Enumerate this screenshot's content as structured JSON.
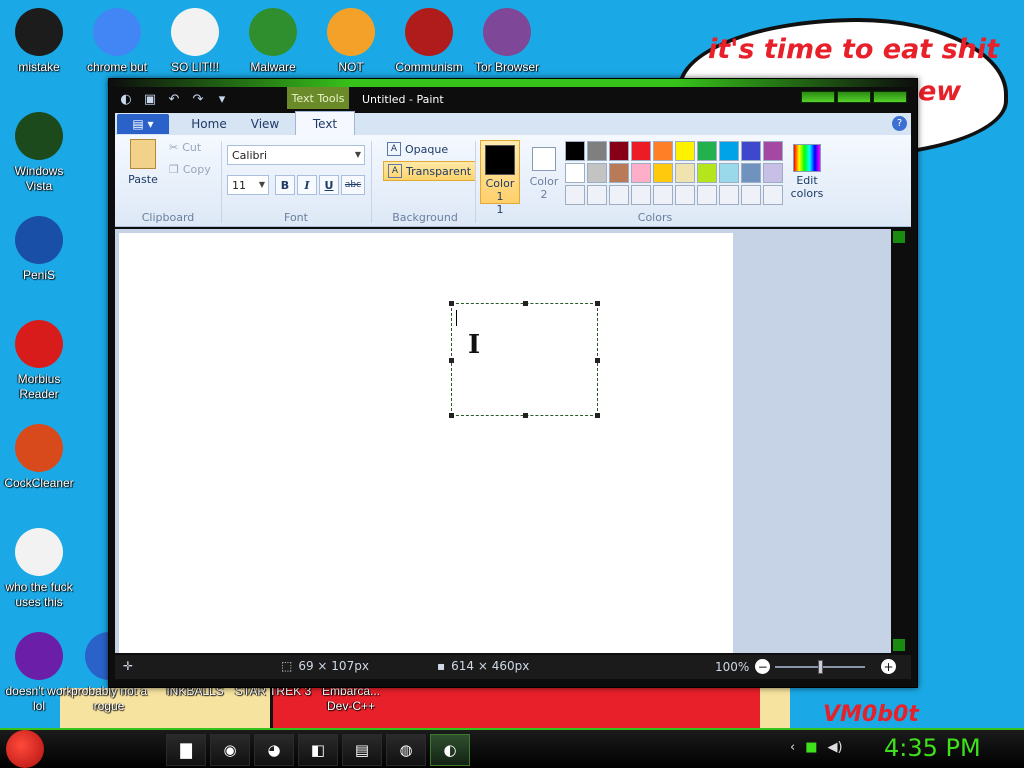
{
  "wallpaper": {
    "bubble_line1": "it's time to eat shit",
    "bubble_line2": "ew",
    "corner_text": "VM0b0t"
  },
  "desktop_icons": [
    {
      "label": "mistake",
      "icon": "razer-icon",
      "color": "#1c1c1c"
    },
    {
      "label": "chrome but nor",
      "icon": "chrome-icon",
      "color": "#4285f4"
    },
    {
      "label": "SO LIT!!!",
      "icon": "solitaire-icon",
      "color": "#f2f2f2"
    },
    {
      "label": "Malware",
      "icon": "shield-icon",
      "color": "#2f8f2f"
    },
    {
      "label": "NOT",
      "icon": "bad-piggies-icon",
      "color": "#f4a12a"
    },
    {
      "label": "Communism",
      "icon": "emblem-icon",
      "color": "#b01c1c"
    },
    {
      "label": "Tor Browser",
      "icon": "tor-icon",
      "color": "#7e4798"
    },
    {
      "label": "Windows Vista",
      "icon": "recycle-icon",
      "color": "#1c4a1c"
    },
    {
      "label": "PeniS",
      "icon": "photoshop-icon",
      "color": "#1a4fa8"
    },
    {
      "label": "Morbius Reader",
      "icon": "acrobat-icon",
      "color": "#d81c1c"
    },
    {
      "label": "CockCleaner",
      "icon": "ccleaner-icon",
      "color": "#d84a1c"
    },
    {
      "label": "who the fuck uses this",
      "icon": "bolt-icon",
      "color": "#f2f2f2"
    },
    {
      "label": "doesn't work lol",
      "icon": "yahoo-icon",
      "color": "#6b1fa8"
    },
    {
      "label": "probably not a rogue",
      "icon": "app-icon",
      "color": "#2a62c9"
    },
    {
      "label": "INKBALLS",
      "icon": "app-icon",
      "color": "#2a62c9"
    },
    {
      "label": "STAR TREK 3",
      "icon": "app-icon",
      "color": "#2a62c9"
    },
    {
      "label": "Embarca... Dev-C++",
      "icon": "app-icon",
      "color": "#2a62c9"
    }
  ],
  "window": {
    "title": "Untitled - Paint",
    "context_tab": "Text Tools",
    "tabs": [
      {
        "label": "Home",
        "active": false
      },
      {
        "label": "View",
        "active": false
      },
      {
        "label": "Text",
        "active": true
      }
    ],
    "clipboard": {
      "paste": "Paste",
      "cut": "Cut",
      "copy": "Copy",
      "group": "Clipboard"
    },
    "font": {
      "family": "Calibri",
      "size": "11",
      "bold": "B",
      "italic": "I",
      "underline": "U",
      "strike": "abc",
      "group": "Font"
    },
    "background": {
      "opaque": "Opaque",
      "transparent": "Transparent",
      "group": "Background"
    },
    "colors": {
      "color1_label": "Color 1",
      "color1_num": "1",
      "color2_label": "Color",
      "color2_num": "2",
      "edit_label": "Edit colors",
      "group": "Colors",
      "palette": [
        "#000000",
        "#7f7f7f",
        "#880015",
        "#ed1c24",
        "#ff7f27",
        "#fff200",
        "#22b14c",
        "#00a2e8",
        "#3f48cc",
        "#a349a4",
        "#ffffff",
        "#c3c3c3",
        "#b97a57",
        "#ffaec9",
        "#ffc90e",
        "#efe4b0",
        "#b5e61d",
        "#99d9ea",
        "#7092be",
        "#c8bfe7",
        "#eef2f8",
        "#eef2f8",
        "#eef2f8",
        "#eef2f8",
        "#eef2f8",
        "#eef2f8",
        "#eef2f8",
        "#eef2f8",
        "#eef2f8",
        "#eef2f8"
      ]
    },
    "status": {
      "selection_size": "69 × 107px",
      "canvas_size": "614 × 460px",
      "zoom": "100%"
    }
  },
  "taskbar": {
    "clock": "4:35 PM",
    "apps": [
      {
        "icon": "folder-icon",
        "glyph": "▇"
      },
      {
        "icon": "chrome-icon",
        "glyph": "◉"
      },
      {
        "icon": "firefox-icon",
        "glyph": "◕"
      },
      {
        "icon": "app-icon",
        "glyph": "◧"
      },
      {
        "icon": "notepad-icon",
        "glyph": "▤"
      },
      {
        "icon": "tor-icon",
        "glyph": "◍"
      },
      {
        "icon": "paint-icon",
        "glyph": "◐"
      }
    ]
  }
}
